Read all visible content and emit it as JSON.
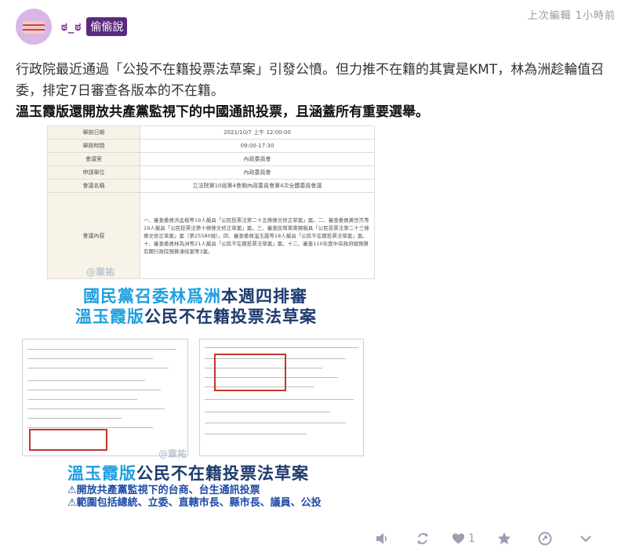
{
  "post": {
    "username": "ಠ_ಠ",
    "board": "偷偷說",
    "edited": "上次編輯 1小時前",
    "paragraph1": "行政院最近通過「公投不在籍投票法草案」引發公憤。但力推不在籍的其實是KMT，林為洲趁輪值召委，排定7日審查各版本的不在籍。",
    "paragraph2": "溫玉霞版還開放共產黨監視下的中國通訊投票，且涵蓋所有重要選舉。"
  },
  "document_table": [
    {
      "key": "舉辦日期",
      "value": "2021/10/7 上午 12:00:00"
    },
    {
      "key": "舉辦時間",
      "value": "09:00-17:30"
    },
    {
      "key": "會議室",
      "value": "內政委員會"
    },
    {
      "key": "申請單位",
      "value": "內政委員會"
    },
    {
      "key": "會議名稱",
      "value": "立法院第10屆第4會期內政委員會第4次全體委員會議"
    },
    {
      "key": "會議內容",
      "value": "一、審查委員洪孟楷等19人擬具「公民投票法第二十五條條文修正草案」案。二、審查委員黃世杰等19人擬具「公民投票法第十條條文修正草案」案。三、審查民眾黨黨團擬具「公民投票法第二十三條條文修正草案」案（第25580號）。四、審查委員溫玉霞等18人擬具「公民不在籍投票法草案」案。十、審查委員林為洲等21人擬具「公民不在籍投票法草案」案。十二、審查110年度中央政府總預算有關行政院預算凍結案等3案。"
    }
  ],
  "headlines": {
    "h1_blue": "國民黨召委林爲洲",
    "h1_navy": "本週四排審",
    "h2_blue": "溫玉霞版",
    "h2_navy": "公民不在籍投票法草案",
    "h3_blue": "溫玉霞版",
    "h3_navy": "公民不在籍投票法草案"
  },
  "bullets": [
    "⚠開放共產黨監視下的台商、台生通訊投票",
    "⚠範圍包括總統、立委、直轄市長、縣市長、議員、公投"
  ],
  "watermark": "@章祐",
  "actions": {
    "like_count": "1"
  }
}
